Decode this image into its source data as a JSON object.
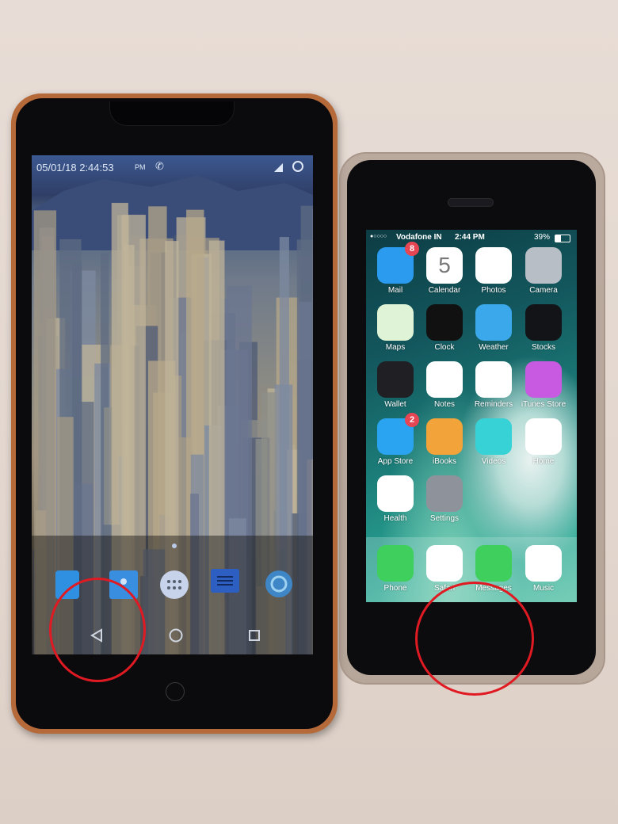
{
  "scene": "Two smartphones side by side on a beige surface, with red circles highlighting navigation areas",
  "android_phone": {
    "status_bar": {
      "datetime": "05/01/18 2:44:53",
      "ampm": "PM",
      "icons": [
        "call-forward-icon",
        "signal-icon",
        "sync-circle-icon"
      ]
    },
    "wallpaper": "city-skyline",
    "home_icons": [
      {
        "name": "files-icon",
        "color": "#2f8fe0"
      },
      {
        "name": "contacts-icon",
        "color": "#3a8ee0"
      },
      {
        "name": "app-drawer-icon",
        "color": "#c7d3ea"
      },
      {
        "name": "messages-icon",
        "color": "#2d5fc2"
      },
      {
        "name": "settings-icon",
        "color": "#3f86c6"
      }
    ],
    "nav_bar": {
      "back": "back-icon",
      "home": "home-icon",
      "recents": "recents-icon"
    },
    "highlight": "back-button"
  },
  "iphone": {
    "status_bar": {
      "signal": "●○○○○",
      "carrier": "Vodafone IN",
      "time": "2:44 PM",
      "battery": "39%"
    },
    "apps": [
      {
        "label": "Mail",
        "badge": "8",
        "color": "#2b9bf0"
      },
      {
        "label": "Calendar",
        "badge": "",
        "color": "#ffffff",
        "glyph": "5"
      },
      {
        "label": "Photos",
        "badge": "",
        "color": "#ffffff"
      },
      {
        "label": "Camera",
        "badge": "",
        "color": "#b8bec6"
      },
      {
        "label": "Maps",
        "badge": "",
        "color": "#dff3d6"
      },
      {
        "label": "Clock",
        "badge": "",
        "color": "#111111"
      },
      {
        "label": "Weather",
        "badge": "",
        "color": "#3aa8ea"
      },
      {
        "label": "Stocks",
        "badge": "",
        "color": "#121418"
      },
      {
        "label": "Wallet",
        "badge": "",
        "color": "#1f1f24"
      },
      {
        "label": "Notes",
        "badge": "",
        "color": "#ffffff"
      },
      {
        "label": "Reminders",
        "badge": "",
        "color": "#ffffff"
      },
      {
        "label": "iTunes Store",
        "badge": "",
        "color": "#c75ae0"
      },
      {
        "label": "App Store",
        "badge": "2",
        "color": "#2aa3f0"
      },
      {
        "label": "iBooks",
        "badge": "",
        "color": "#f2a43a"
      },
      {
        "label": "Videos",
        "badge": "",
        "color": "#36d2d6"
      },
      {
        "label": "Home",
        "badge": "",
        "color": "#ffffff"
      },
      {
        "label": "Health",
        "badge": "",
        "color": "#ffffff"
      },
      {
        "label": "Settings",
        "badge": "",
        "color": "#8e939b"
      }
    ],
    "dock": [
      {
        "label": "Phone",
        "color": "#3fcf5c"
      },
      {
        "label": "Safari",
        "color": "#ffffff"
      },
      {
        "label": "Messages",
        "color": "#3fcf5c"
      },
      {
        "label": "Music",
        "color": "#ffffff"
      }
    ],
    "highlight": "home-button-area"
  },
  "annotation_color": "#e01a22"
}
